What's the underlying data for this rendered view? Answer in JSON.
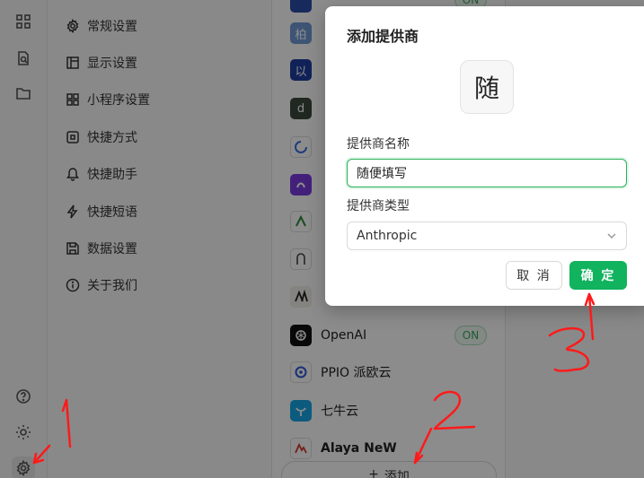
{
  "menu": {
    "items": [
      {
        "label": "常规设置",
        "icon": "gear-icon"
      },
      {
        "label": "显示设置",
        "icon": "layout-icon"
      },
      {
        "label": "小程序设置",
        "icon": "grid-icon"
      },
      {
        "label": "快捷方式",
        "icon": "command-icon"
      },
      {
        "label": "快捷助手",
        "icon": "bell-icon"
      },
      {
        "label": "快捷短语",
        "icon": "bolt-icon"
      },
      {
        "label": "数据设置",
        "icon": "save-icon"
      },
      {
        "label": "关于我们",
        "icon": "info-icon"
      }
    ]
  },
  "providers": {
    "items": [
      {
        "label": "OpenAI",
        "badge": "ON"
      },
      {
        "label": "PPIO 派欧云"
      },
      {
        "label": "七牛云"
      },
      {
        "label": "Alaya NeW"
      }
    ],
    "partial_glyphs": [
      "柏",
      "以",
      "d"
    ],
    "add_label": "添加",
    "top_badge": "ON"
  },
  "modal": {
    "title": "添加提供商",
    "avatar_char": "随",
    "name_label": "提供商名称",
    "name_value": "随便填写",
    "type_label": "提供商类型",
    "type_value": "Anthropic",
    "cancel_label": "取 消",
    "ok_label": "确 定"
  },
  "colors": {
    "accent": "#11b35e",
    "annotation": "#ff1a1a"
  }
}
